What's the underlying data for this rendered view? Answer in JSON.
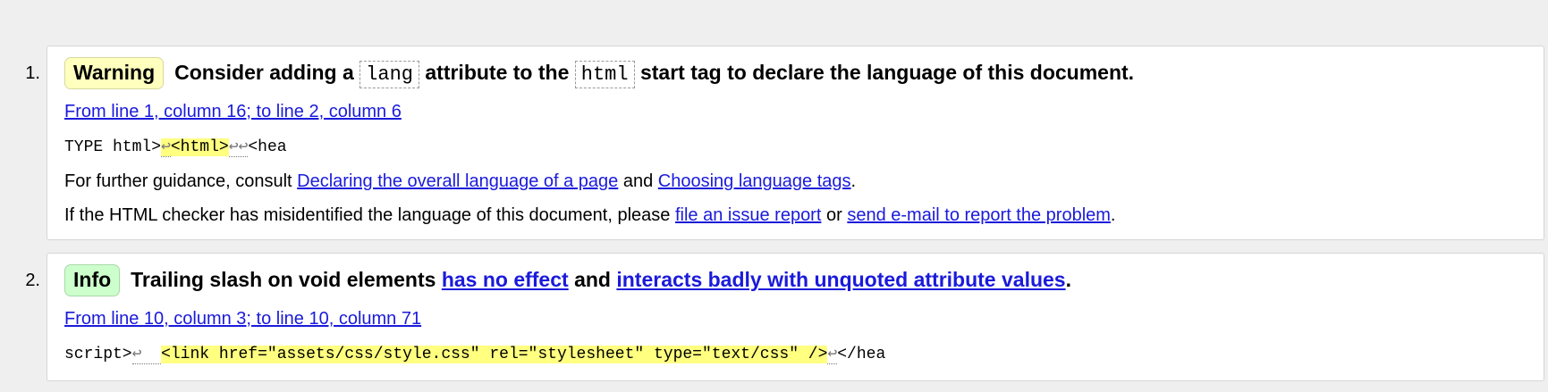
{
  "messages": [
    {
      "number": "1.",
      "badge": "Warning",
      "title_part1": "Consider adding a",
      "code1": "lang",
      "title_part2": "attribute to the",
      "code2": "html",
      "title_part3": "start tag to declare the language of this document.",
      "location": "From line 1, column 16; to line 2, column 6",
      "extract_before": "TYPE html>",
      "extract_ret1": "↩",
      "extract_highlight": "<html>",
      "extract_ret2": "↩↩",
      "extract_after": "<hea",
      "guidance_prefix": "For further guidance, consult",
      "guidance_link1": "Declaring the overall language of a page",
      "guidance_and": "and",
      "guidance_link2": "Choosing language tags",
      "guidance_end": ".",
      "report_prefix": "If the HTML checker has misidentified the language of this document, please",
      "report_link1": "file an issue report",
      "report_or": "or",
      "report_link2": "send e-mail to report the problem",
      "report_end": "."
    },
    {
      "number": "2.",
      "badge": "Info",
      "title_part1": "Trailing slash on void elements",
      "title_link1": "has no effect",
      "title_and": "and",
      "title_link2": "interacts badly with unquoted attribute values",
      "title_end": ".",
      "location": "From line 10, column 3; to line 10, column 71",
      "extract_before": "script>",
      "extract_ret1": "↩  ",
      "extract_highlight": "<link href=\"assets/css/style.css\" rel=\"stylesheet\" type=\"text/css\" />",
      "extract_ret2": "↩",
      "extract_after": "</hea"
    }
  ]
}
